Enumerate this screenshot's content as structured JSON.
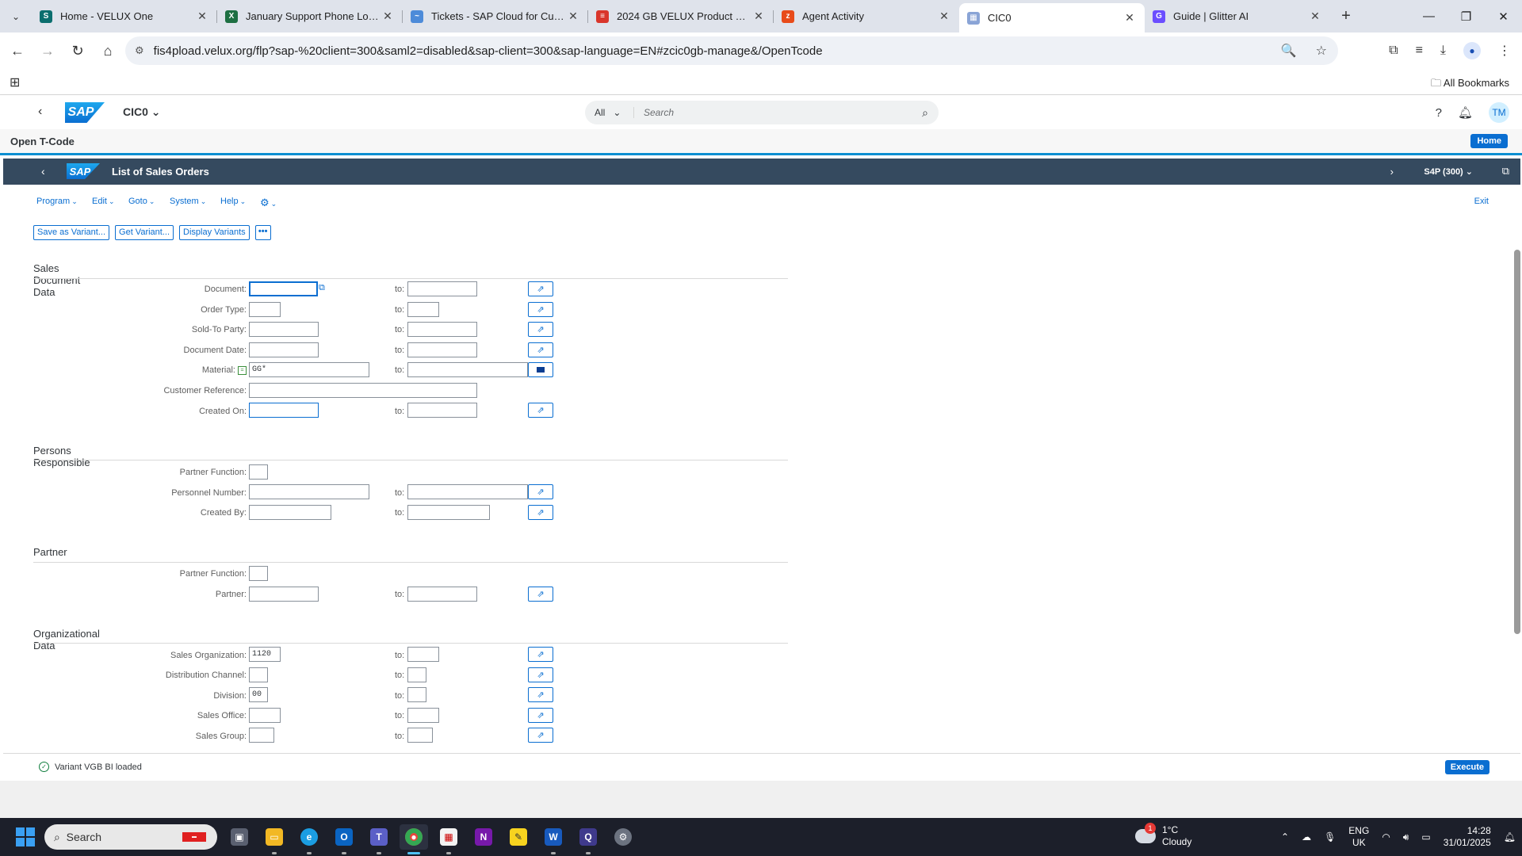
{
  "browser": {
    "tabs": [
      {
        "title": "Home - VELUX One",
        "icon": "velux-one-icon",
        "color": "#0b6e6e",
        "glyph": "S"
      },
      {
        "title": "January Support Phone Log 2025",
        "icon": "excel-icon",
        "color": "#1d6f42",
        "glyph": "X"
      },
      {
        "title": "Tickets - SAP Cloud for Customer",
        "icon": "sap-c4c-icon",
        "color": "#4d8bd9",
        "glyph": "~"
      },
      {
        "title": "2024 GB VELUX Product Catalogue",
        "icon": "pdf-stripes-icon",
        "color": "#d9362b",
        "glyph": "≡"
      },
      {
        "title": "Agent Activity",
        "icon": "zendesk-icon",
        "color": "#e84b1a",
        "glyph": "z"
      },
      {
        "title": "CIC0",
        "icon": "sap-tab-icon",
        "color": "#8aa4d6",
        "glyph": "▦"
      },
      {
        "title": "Guide | Glitter AI",
        "icon": "glitter-icon",
        "color": "#6b4eff",
        "glyph": "G"
      }
    ],
    "url": "fis4pload.velux.org/flp?sap-%20client=300&saml2=disabled&sap-client=300&sap-language=EN#zcic0gb-manage&/OpenTcode",
    "bookmarks_label": "All Bookmarks"
  },
  "shell": {
    "logo": "SAP",
    "app_title": "CIC0",
    "search_category": "All",
    "search_placeholder": "Search",
    "user_initials": "TM"
  },
  "page": {
    "title": "Open T-Code",
    "home_label": "Home"
  },
  "gui": {
    "logo": "SAP",
    "title": "List of Sales Orders",
    "system": "S4P (300)",
    "menus": [
      "Program",
      "Edit",
      "Goto",
      "System",
      "Help"
    ],
    "exit_label": "Exit",
    "toolbar": [
      "Save as Variant...",
      "Get Variant...",
      "Display Variants"
    ],
    "more_label": "•••"
  },
  "form": {
    "to_label": "to:",
    "sections": [
      {
        "title": "Sales Document Data"
      },
      {
        "title": "Persons Responsible"
      },
      {
        "title": "Partner"
      },
      {
        "title": "Organizational Data"
      }
    ],
    "rows": {
      "document": {
        "label": "Document:",
        "from": "",
        "to": ""
      },
      "order_type": {
        "label": "Order Type:",
        "from": "",
        "to": ""
      },
      "sold_to": {
        "label": "Sold-To Party:",
        "from": "",
        "to": ""
      },
      "doc_date": {
        "label": "Document Date:",
        "from": "",
        "to": ""
      },
      "material": {
        "label": "Material:",
        "from": "GG*",
        "to": ""
      },
      "cust_ref": {
        "label": "Customer Reference:",
        "from": ""
      },
      "created_on": {
        "label": "Created On:",
        "from": "",
        "to": ""
      },
      "pr_partner_fn": {
        "label": "Partner Function:",
        "from": ""
      },
      "personnel": {
        "label": "Personnel Number:",
        "from": "",
        "to": ""
      },
      "created_by": {
        "label": "Created By:",
        "from": "",
        "to": ""
      },
      "p_partner_fn": {
        "label": "Partner Function:",
        "from": ""
      },
      "partner": {
        "label": "Partner:",
        "from": "",
        "to": ""
      },
      "sales_org": {
        "label": "Sales Organization:",
        "from": "1120",
        "to": ""
      },
      "dist_channel": {
        "label": "Distribution Channel:",
        "from": "",
        "to": ""
      },
      "division": {
        "label": "Division:",
        "from": "00",
        "to": ""
      },
      "sales_office": {
        "label": "Sales Office:",
        "from": "",
        "to": ""
      },
      "sales_group": {
        "label": "Sales Group:",
        "from": "",
        "to": ""
      }
    }
  },
  "footer": {
    "status": "Variant VGB BI loaded",
    "execute_label": "Execute"
  },
  "taskbar": {
    "search_placeholder": "Search",
    "weather_temp": "1°C",
    "weather_desc": "Cloudy",
    "weather_badge": "1",
    "lang_top": "ENG",
    "lang_bottom": "UK",
    "time": "14:28",
    "date": "31/01/2025"
  },
  "colors": {
    "sap_blue": "#0a6ed1",
    "gui_header": "#354a5f",
    "success": "#107e3e"
  }
}
